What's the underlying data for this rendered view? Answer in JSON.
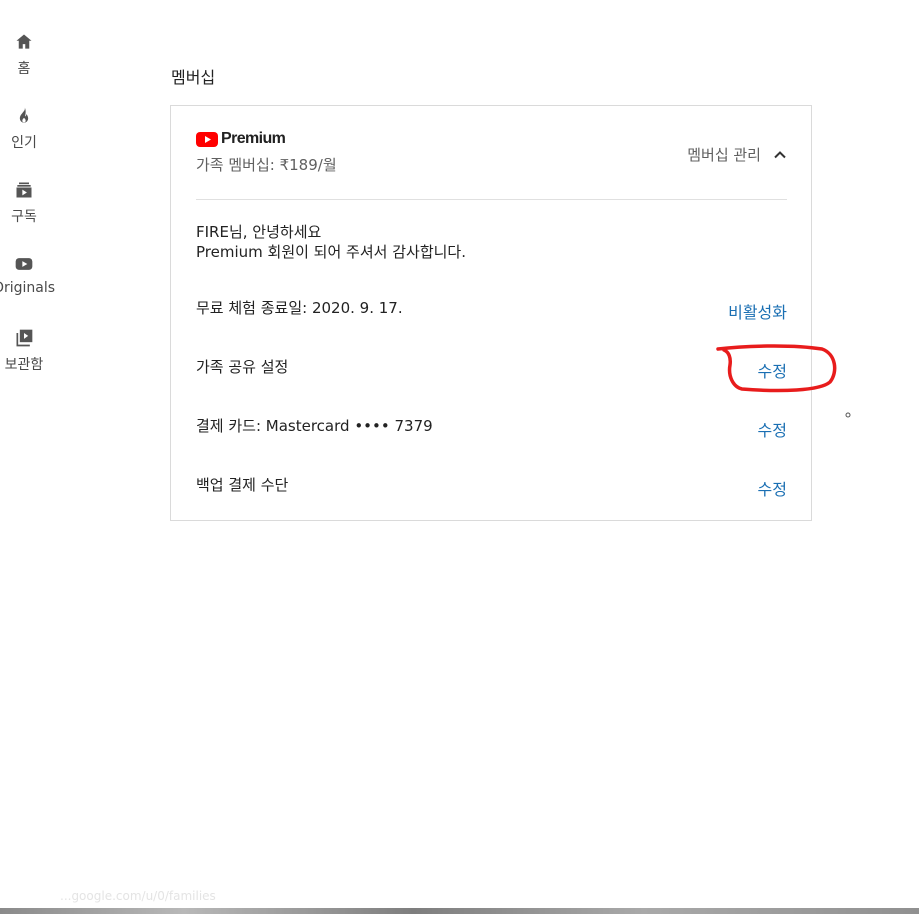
{
  "sidebar": {
    "items": [
      {
        "label": "홈",
        "icon": "home-icon"
      },
      {
        "label": "인기",
        "icon": "flame-icon"
      },
      {
        "label": "구독",
        "icon": "subscriptions-icon"
      },
      {
        "label": "Originals",
        "icon": "youtube-play-icon"
      },
      {
        "label": "보관함",
        "icon": "library-icon"
      }
    ]
  },
  "main": {
    "section_title": "멤버십",
    "card": {
      "brand": "Premium",
      "plan": "가족 멤버십: ₹189/월",
      "manage_label": "멤버십 관리",
      "greeting_line1": "FIRE님, 안녕하세요",
      "greeting_line2": "Premium 회원이 되어 주셔서 감사합니다.",
      "rows": [
        {
          "text": "무료 체험 종료일: 2020. 9. 17.",
          "action": "비활성화"
        },
        {
          "text": "가족 공유 설정",
          "action": "수정"
        },
        {
          "text": "결제 카드: Mastercard •••• 7379",
          "action": "수정"
        },
        {
          "text": "백업 결제 수단",
          "action": "수정"
        }
      ]
    }
  },
  "footer": {
    "faded_url": "...google.com/u/0/families"
  },
  "colors": {
    "link": "#1a6fb3",
    "brand_red": "#ff0000",
    "annotation": "#e81c1c"
  }
}
